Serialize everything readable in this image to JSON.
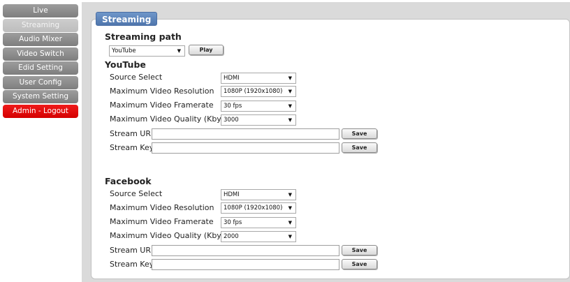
{
  "sidebar": {
    "items": [
      {
        "label": "Live"
      },
      {
        "label": "Streaming"
      },
      {
        "label": "Audio Mixer"
      },
      {
        "label": "Video Switch"
      },
      {
        "label": "Edid Setting"
      },
      {
        "label": "User Config"
      },
      {
        "label": "System Setting"
      },
      {
        "label": "Admin - Logout"
      }
    ],
    "active": "Streaming"
  },
  "panel": {
    "title": "Streaming"
  },
  "streaming_path": {
    "heading": "Streaming path",
    "selected": "YouTube",
    "play_label": "Play"
  },
  "youtube": {
    "heading": "YouTube",
    "source_label": "Source Select",
    "source_value": "HDMI",
    "resolution_label": "Maximum Video Resolution",
    "resolution_value": "1080P (1920x1080)",
    "framerate_label": "Maximum Video Framerate",
    "framerate_value": "30 fps",
    "quality_label": "Maximum Video Quality (Kbyte)",
    "quality_value": "3000",
    "url_label": "Stream URL",
    "url_value": "",
    "key_label": "Stream Key",
    "key_value": "",
    "save_label": "Save"
  },
  "facebook": {
    "heading": "Facebook",
    "source_label": "Source Select",
    "source_value": "HDMI",
    "resolution_label": "Maximum Video Resolution",
    "resolution_value": "1080P (1920x1080)",
    "framerate_label": "Maximum Video Framerate",
    "framerate_value": "30 fps",
    "quality_label": "Maximum Video Quality (Kbyte)",
    "quality_value": "2000",
    "url_label": "Stream URL",
    "url_value": "",
    "key_label": "Stream Key",
    "key_value": "",
    "save_label": "Save"
  },
  "icons": {
    "dropdown": "chevron-down-icon"
  },
  "colors": {
    "tab_blue": "#5b82b8",
    "nav_gray": "#8e8e8e",
    "nav_active": "#c6c6c6",
    "logout_red": "#e60a0a",
    "background_gray": "#dadada"
  }
}
